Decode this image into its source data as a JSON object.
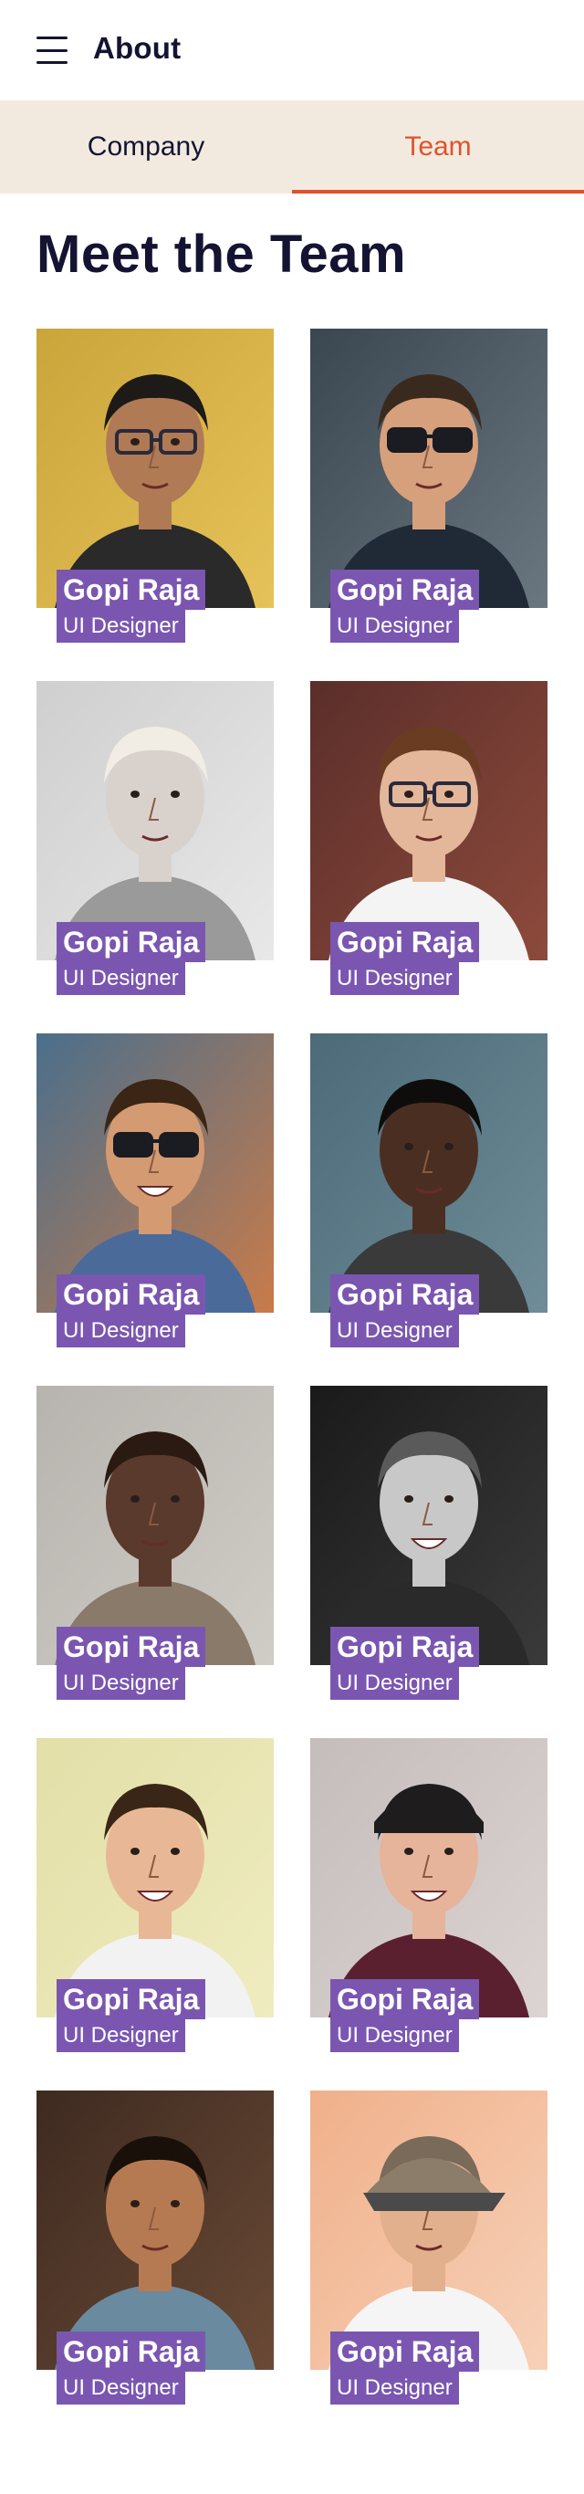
{
  "appbar": {
    "menu_icon": "hamburger-menu-icon",
    "title": "About"
  },
  "tabs": [
    {
      "label": "Company",
      "active": false
    },
    {
      "label": "Team",
      "active": true
    }
  ],
  "colors": {
    "accent": "#e0522c",
    "tab_background": "#f2eadf",
    "tag_background": "#7a56b1",
    "text": "#141432"
  },
  "section": {
    "title": "Meet the Team"
  },
  "members": [
    {
      "name": "Gopi Raja",
      "role": "UI Designer",
      "photo": "man-with-glasses-photo"
    },
    {
      "name": "Gopi Raja",
      "role": "UI Designer",
      "photo": "man-with-sunglasses-in-car-photo"
    },
    {
      "name": "Gopi Raja",
      "role": "UI Designer",
      "photo": "blonde-woman-bw-photo"
    },
    {
      "name": "Gopi Raja",
      "role": "UI Designer",
      "photo": "man-with-glasses-brick-wall-photo"
    },
    {
      "name": "Gopi Raja",
      "role": "UI Designer",
      "photo": "laughing-man-sunglasses-photo"
    },
    {
      "name": "Gopi Raja",
      "role": "UI Designer",
      "photo": "man-with-curly-hair-photo"
    },
    {
      "name": "Gopi Raja",
      "role": "UI Designer",
      "photo": "woman-looking-up-photo"
    },
    {
      "name": "Gopi Raja",
      "role": "UI Designer",
      "photo": "smiling-young-man-bw-photo"
    },
    {
      "name": "Gopi Raja",
      "role": "UI Designer",
      "photo": "laughing-man-yellow-background-photo"
    },
    {
      "name": "Gopi Raja",
      "role": "UI Designer",
      "photo": "woman-in-beanie-photo"
    },
    {
      "name": "Gopi Raja",
      "role": "UI Designer",
      "photo": "woman-on-phone-photo"
    },
    {
      "name": "Gopi Raja",
      "role": "UI Designer",
      "photo": "man-in-cap-photo"
    }
  ]
}
